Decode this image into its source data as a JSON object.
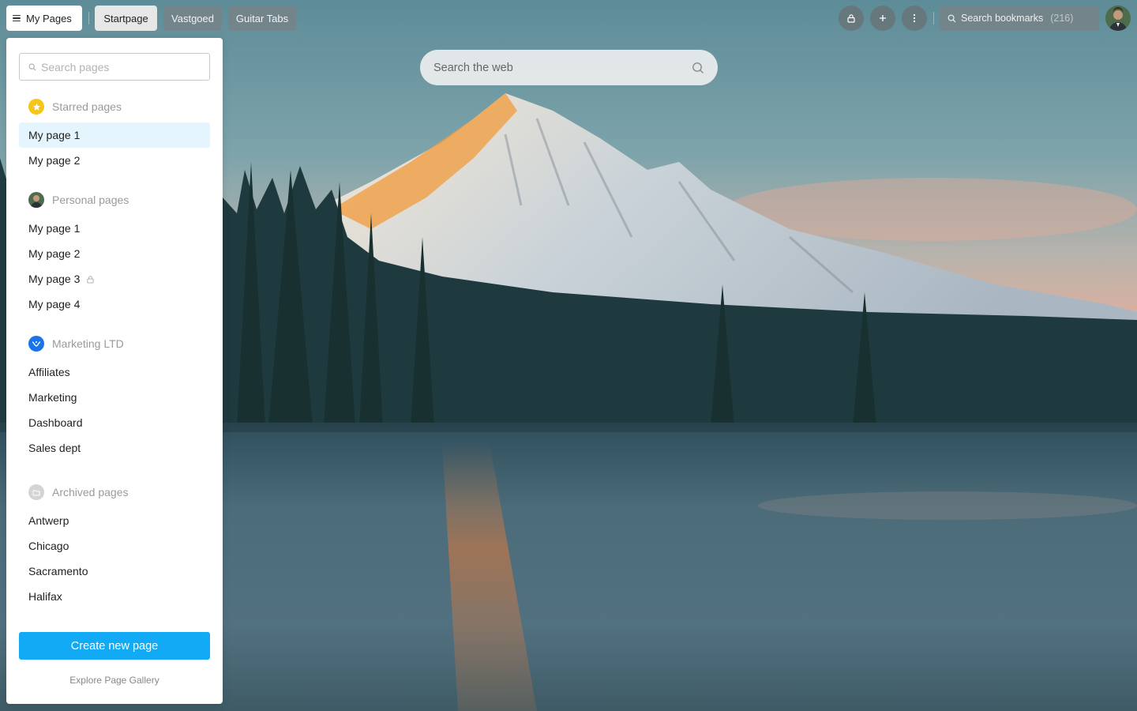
{
  "topbar": {
    "menu_button": "My Pages",
    "tabs": [
      {
        "label": "Startpage",
        "active": true
      },
      {
        "label": "Vastgoed",
        "active": false
      },
      {
        "label": "Guitar Tabs",
        "active": false
      }
    ],
    "icons": [
      "lock-icon",
      "plus-icon",
      "more-vertical-icon"
    ],
    "bookmark_search": {
      "placeholder": "Search bookmarks",
      "count": "(216)"
    }
  },
  "web_search": {
    "placeholder": "Search the web"
  },
  "sidebar": {
    "search_placeholder": "Search pages",
    "sections": [
      {
        "title": "Starred pages",
        "icon": "star-icon",
        "icon_color": "#f5c518",
        "items": [
          {
            "label": "My page 1",
            "selected": true
          },
          {
            "label": "My page 2"
          }
        ]
      },
      {
        "title": "Personal pages",
        "icon": "avatar",
        "items": [
          {
            "label": "My page 1"
          },
          {
            "label": "My page 2"
          },
          {
            "label": "My page 3",
            "locked": true
          },
          {
            "label": "My page 4"
          }
        ]
      },
      {
        "title": "Marketing LTD",
        "icon": "marketing-logo-icon",
        "icon_color": "#1a73e8",
        "items": [
          {
            "label": "Affiliates"
          },
          {
            "label": "Marketing"
          },
          {
            "label": "Dashboard"
          },
          {
            "label": "Sales dept"
          }
        ]
      },
      {
        "title": "Archived pages",
        "icon": "folder-icon",
        "icon_color": "#cfcfcf",
        "items": [
          {
            "label": "Antwerp"
          },
          {
            "label": "Chicago"
          },
          {
            "label": "Sacramento"
          },
          {
            "label": "Halifax"
          }
        ]
      }
    ],
    "create_button": "Create new page",
    "gallery_link": "Explore Page Gallery"
  },
  "colors": {
    "accent": "#12aaf4",
    "selected_bg": "#e5f5fd"
  }
}
